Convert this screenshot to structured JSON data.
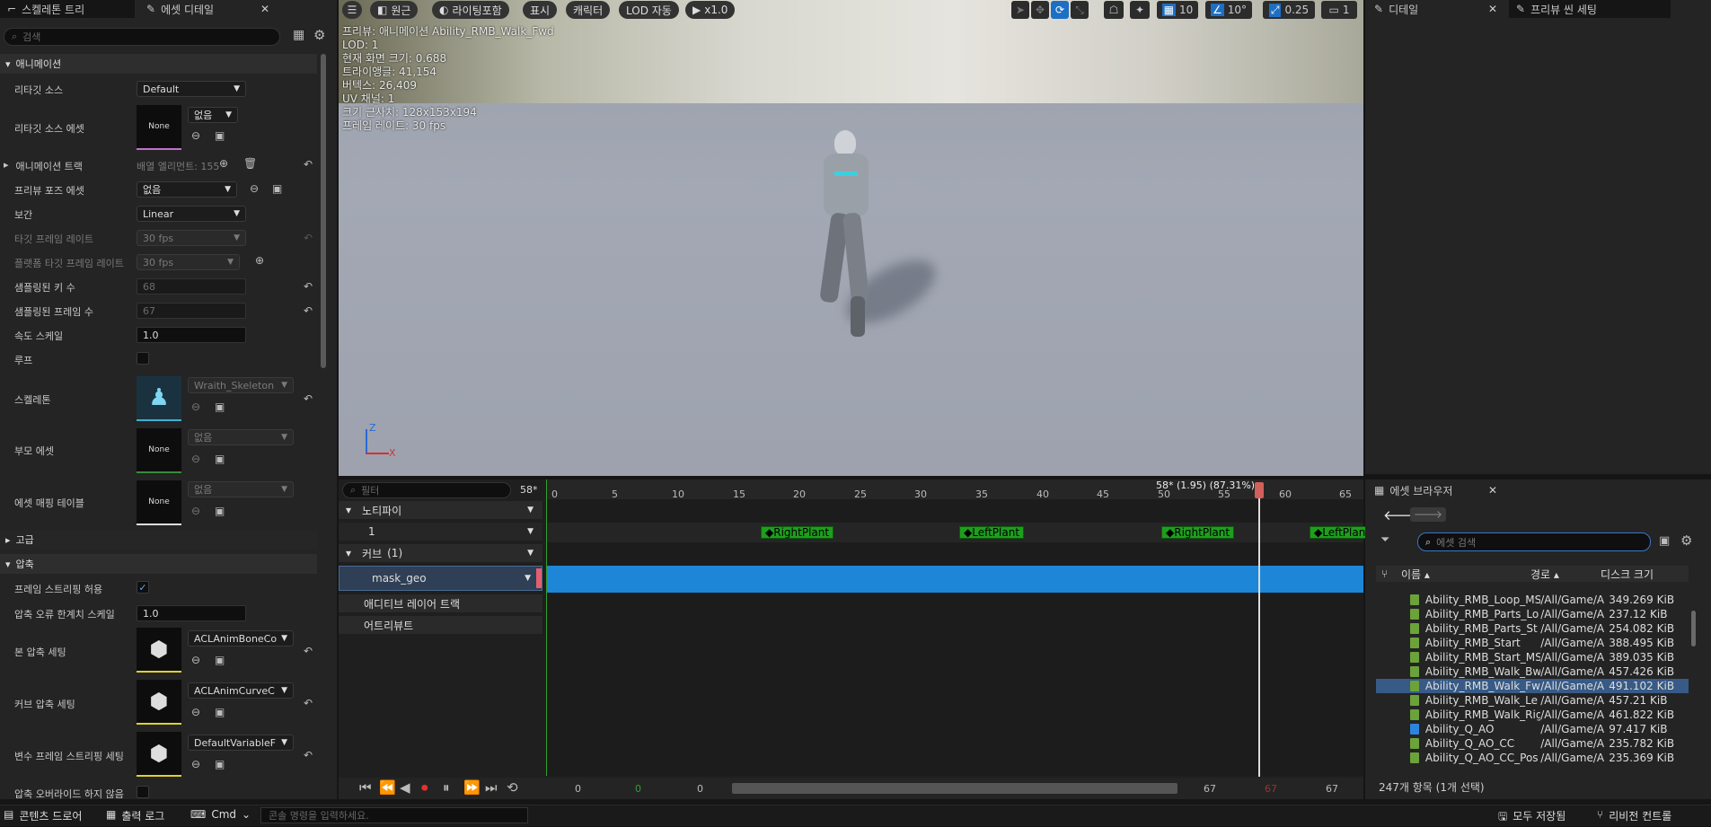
{
  "left_tabs": [
    {
      "label": "스켈레톤 트리"
    },
    {
      "label": "에셋 디테일"
    }
  ],
  "left_search_placeholder": "검색",
  "sections": {
    "animation": "애니메이션",
    "advanced": "고급",
    "compression": "압축"
  },
  "props": {
    "retarget_source": {
      "label": "리타깃 소스",
      "value": "Default"
    },
    "retarget_source_asset": {
      "label": "리타깃 소스 에셋",
      "thumb": "None",
      "value": "없음"
    },
    "anim_track": {
      "label": "애니메이션 트랙",
      "value": "배열 엘리먼트: 155"
    },
    "preview_pose": {
      "label": "프리뷰 포즈 에셋",
      "value": "없음"
    },
    "interp": {
      "label": "보간",
      "value": "Linear"
    },
    "target_fr": {
      "label": "타깃 프레임 레이트",
      "value": "30 fps"
    },
    "platform_fr": {
      "label": "플랫폼 타깃 프레임 레이트",
      "value": "30 fps"
    },
    "sampled_keys": {
      "label": "샘플링된 키 수",
      "value": "68"
    },
    "sampled_frames": {
      "label": "샘플링된 프레임 수",
      "value": "67"
    },
    "rate_scale": {
      "label": "속도 스케일",
      "value": "1.0"
    },
    "loop": {
      "label": "루프"
    },
    "skeleton": {
      "label": "스켈레톤",
      "value": "Wraith_Skeleton"
    },
    "parent_asset": {
      "label": "부모 에셋",
      "thumb": "None",
      "value": "없음"
    },
    "asset_mapping": {
      "label": "에셋 매핑 테이블",
      "thumb": "None",
      "value": "없음"
    },
    "allow_strip": {
      "label": "프레임 스트리핑 허용"
    },
    "err_scale": {
      "label": "압축 오류 한계치 스케일",
      "value": "1.0"
    },
    "bone_comp": {
      "label": "본 압축 세팅",
      "value": "ACLAnimBoneCo"
    },
    "curve_comp": {
      "label": "커브 압축 세팅",
      "value": "ACLAnimCurveC"
    },
    "var_strip": {
      "label": "변수 프레임 스트리핑 세팅",
      "value": "DefaultVariableF"
    },
    "no_override": {
      "label": "압축 오버라이드 하지 않음"
    }
  },
  "viewport": {
    "buttons": [
      "원근",
      "라이팅포함",
      "표시",
      "캐릭터",
      "LOD 자동",
      "x1.0"
    ],
    "grid": "10",
    "angle": "10°",
    "scale": "0.25",
    "cams": "1",
    "info": [
      "프리뷰: 애니메이션 Ability_RMB_Walk_Fwd",
      "LOD: 1",
      "현재 화면 크기: 0.688",
      "트라이앵글: 41,154",
      "버텍스: 26,409",
      "UV 채널: 1",
      "크기 근사치: 128x153x194",
      "프레임 레이트: 30 fps"
    ]
  },
  "right_tabs": [
    {
      "label": "디테일"
    },
    {
      "label": "프리뷰 씬 세팅"
    }
  ],
  "timeline": {
    "filter_placeholder": "필터",
    "frame_badge": "58*",
    "playhead": "58* (1.95) (87.31%)",
    "ticks": [
      "0",
      "5",
      "10",
      "15",
      "20",
      "25",
      "30",
      "35",
      "40",
      "45",
      "50",
      "55",
      "60",
      "65"
    ],
    "rows": {
      "notifies": "노티파이",
      "track1": "1",
      "curves": "커브",
      "curve_count": "(1)",
      "mask": "mask_geo",
      "additive": "애디티브 레이어 트랙",
      "attributes": "어트리뷰트"
    },
    "notifies": [
      "RightPlant",
      "LeftPlant",
      "RightPlant",
      "LeftPlant"
    ],
    "bottom": [
      "0",
      "0",
      "0",
      "67",
      "67",
      "67"
    ]
  },
  "asset_browser": {
    "title": "에셋 브라우저",
    "search_placeholder": "에셋 검색",
    "cols": [
      "이름",
      "경로",
      "디스크 크기"
    ],
    "rows": [
      {
        "n": "Ability_RMB_Loop_MS",
        "p": "/All/Game/A",
        "s": "349.269 KiB"
      },
      {
        "n": "Ability_RMB_Parts_Lo",
        "p": "/All/Game/A",
        "s": "237.12 KiB"
      },
      {
        "n": "Ability_RMB_Parts_St",
        "p": "/All/Game/A",
        "s": "254.082 KiB"
      },
      {
        "n": "Ability_RMB_Start",
        "p": "/All/Game/A",
        "s": "388.495 KiB"
      },
      {
        "n": "Ability_RMB_Start_MS",
        "p": "/All/Game/A",
        "s": "389.035 KiB"
      },
      {
        "n": "Ability_RMB_Walk_Bw",
        "p": "/All/Game/A",
        "s": "457.426 KiB"
      },
      {
        "n": "Ability_RMB_Walk_Fw",
        "p": "/All/Game/A",
        "s": "491.102 KiB"
      },
      {
        "n": "Ability_RMB_Walk_Le",
        "p": "/All/Game/A",
        "s": "457.21 KiB"
      },
      {
        "n": "Ability_RMB_Walk_Rig",
        "p": "/All/Game/A",
        "s": "461.822 KiB"
      },
      {
        "n": "Ability_Q_AO",
        "p": "/All/Game/A",
        "s": "97.417 KiB"
      },
      {
        "n": "Ability_Q_AO_CC",
        "p": "/All/Game/A",
        "s": "235.782 KiB"
      },
      {
        "n": "Ability_Q_AO_CC_Pos",
        "p": "/All/Game/A",
        "s": "235.369 KiB"
      }
    ],
    "status": "247개 항목 (1개 선택)"
  },
  "statusbar": {
    "drawer": "콘텐츠 드로어",
    "log": "출력 로그",
    "cmd": "Cmd",
    "console_placeholder": "콘솔 명령을 입력하세요.",
    "save_all": "모두 저장됨",
    "revision": "리비전 컨트롤"
  }
}
